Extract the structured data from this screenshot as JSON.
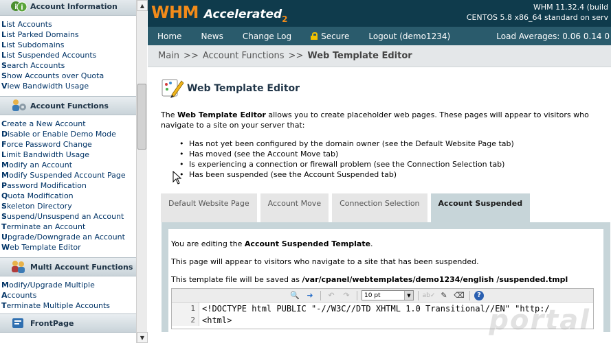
{
  "sidebar": {
    "sections": [
      {
        "title": "Account Information",
        "icon": "info-icon",
        "links": [
          "List Accounts",
          "List Parked Domains",
          "List Subdomains",
          "List Suspended Accounts",
          "Search Accounts",
          "Show Accounts over Quota",
          "View Bandwidth Usage"
        ]
      },
      {
        "title": "Account Functions",
        "icon": "users-gear-icon",
        "links": [
          "Create a New Account",
          "Disable or Enable Demo Mode",
          "Force Password Change",
          "Limit Bandwidth Usage",
          "Modify an Account",
          "Modify Suspended Account Page",
          "Password Modification",
          "Quota Modification",
          "Skeleton Directory",
          "Suspend/Unsuspend an Account",
          "Terminate an Account",
          "Upgrade/Downgrade an Account",
          "Web Template Editor"
        ]
      },
      {
        "title": "Multi Account Functions",
        "icon": "multi-users-icon",
        "links": [
          "Modify/Upgrade Multiple",
          "Accounts",
          "Terminate Multiple Accounts"
        ]
      },
      {
        "title": "FrontPage",
        "icon": "frontpage-icon",
        "links": []
      }
    ]
  },
  "banner": {
    "logo_main": "WHM",
    "logo_accel": "Accelerated",
    "logo_num": "2",
    "server_line1": "WHM 11.32.4 (build",
    "server_line2": "CENTOS 5.8 x86_64 standard on serv"
  },
  "nav": {
    "home": "Home",
    "news": "News",
    "changelog": "Change Log",
    "secure": "Secure",
    "logout": "Logout (demo1234)",
    "load_averages": "Load Averages: 0.06 0.14 0"
  },
  "breadcrumb": {
    "main": "Main",
    "sep": ">>",
    "section": "Account Functions",
    "current": "Web Template Editor"
  },
  "page": {
    "title": "Web Template Editor",
    "intro_pre": "The ",
    "intro_bold": "Web Template Editor",
    "intro_post": " allows you to create placeholder web pages. These pages will appear to visitors who navigate to a site on your server that:",
    "bullets": [
      "Has not yet been configured by the domain owner (see the Default Website Page tab)",
      "Has moved (see the Account Move tab)",
      "Is experiencing a connection or firewall problem (see the Connection Selection tab)",
      "Has been suspended (see the Account Suspended tab)"
    ]
  },
  "tabs": [
    {
      "label": "Default Website Page",
      "active": false
    },
    {
      "label": "Account Move",
      "active": false
    },
    {
      "label": "Connection Selection",
      "active": false
    },
    {
      "label": "Account Suspended",
      "active": true
    }
  ],
  "panel": {
    "editing_pre": "You are editing the ",
    "editing_bold": "Account Suspended Template",
    "editing_post": ".",
    "description": "This page will appear to visitors who navigate to a site that has been suspended.",
    "save_pre": "This template file will be saved as ",
    "save_path": "/var/cpanel/webtemplates/demo1234/english /suspended.tmpl"
  },
  "editor": {
    "font_size": "10 pt",
    "lines": [
      {
        "num": "1",
        "code": "<!DOCTYPE html PUBLIC \"-//W3C//DTD XHTML 1.0 Transitional//EN\" \"http:/"
      },
      {
        "num": "2",
        "code": "<html>"
      }
    ]
  },
  "watermark": "portal"
}
